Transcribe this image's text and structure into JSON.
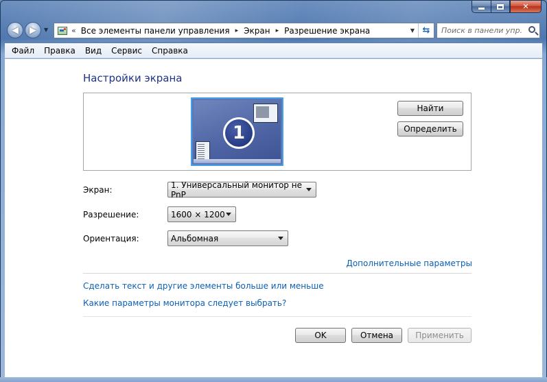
{
  "window": {
    "caption_buttons": [
      "minimize-icon",
      "maximize-icon",
      "close-icon"
    ]
  },
  "nav": {
    "back_icon": "back-arrow-icon",
    "forward_icon": "forward-arrow-icon",
    "address": {
      "lead": "«",
      "crumbs": [
        "Все элементы панели управления",
        "Экран",
        "Разрешение экрана"
      ],
      "separator": "▸"
    },
    "search_placeholder": "Поиск в панели упр..."
  },
  "menu": {
    "items": [
      "Файл",
      "Правка",
      "Вид",
      "Сервис",
      "Справка"
    ]
  },
  "main": {
    "title": "Настройки экрана",
    "monitor_number": "1",
    "find_label": "Найти",
    "identify_label": "Определить",
    "display_label": "Экран:",
    "display_value": "1. Универсальный монитор не PnP",
    "resolution_label": "Разрешение:",
    "resolution_value": "1600 × 1200",
    "orientation_label": "Ориентация:",
    "orientation_value": "Альбомная",
    "advanced_link": "Дополнительные параметры",
    "text_size_link": "Сделать текст и другие элементы больше или меньше",
    "monitor_help_link": "Какие параметры монитора следует выбрать?",
    "ok_label": "OK",
    "cancel_label": "Отмена",
    "apply_label": "Применить"
  },
  "colors": {
    "title": "#1e3287",
    "link": "#0b5fb5",
    "monitor_border": "#4aa0e6"
  }
}
